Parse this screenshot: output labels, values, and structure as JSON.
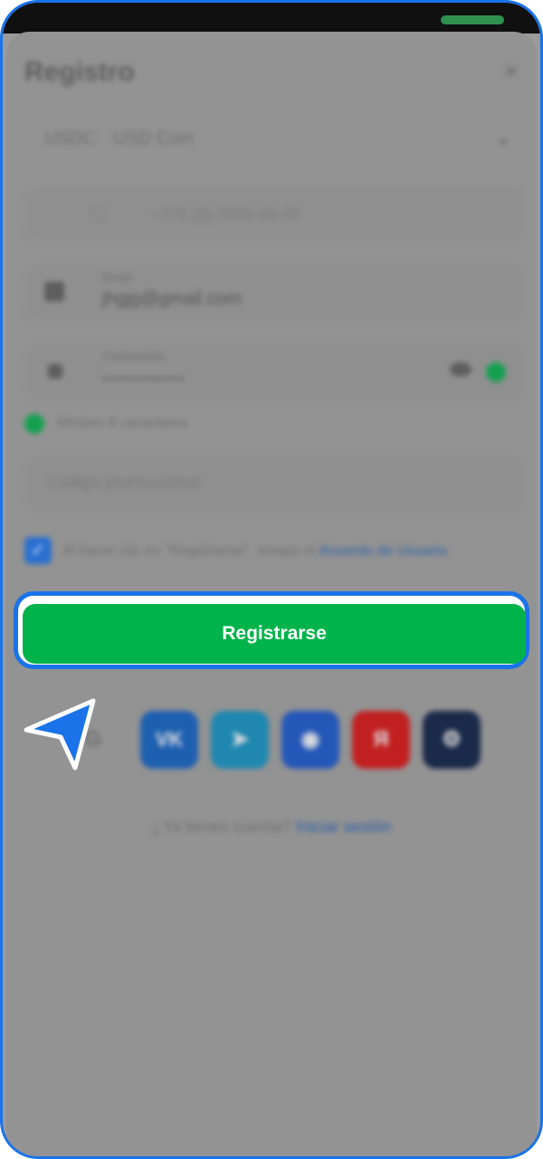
{
  "header": {
    "title": "Registro",
    "close_glyph": "×"
  },
  "currency": {
    "code": "USDC",
    "name": "USD Coin",
    "chevron_glyph": "⌄"
  },
  "phone_field": {
    "value": "+375 (0) 0000-00-00"
  },
  "email_field": {
    "label": "Email",
    "value": "jhgjg@gmail.com"
  },
  "password_field": {
    "label": "Contraseña",
    "value": "••••••••••••••"
  },
  "password_hint": {
    "text": "Mínimo 8 caracteres"
  },
  "promo_field": {
    "placeholder": "Código promocional"
  },
  "terms": {
    "checkbox_glyph": "✓",
    "prefix": "Al hacer clic en \"Registrarse\", acepto el ",
    "link": "Acuerdo de Usuario",
    "suffix": "."
  },
  "actions": {
    "register_label": "Registrarse"
  },
  "socials": {
    "google": "G",
    "vk": "VK",
    "telegram": "➤",
    "ok": "◉",
    "yandex": "Я",
    "steam": "⚙"
  },
  "login": {
    "question": "¿Ya tienes cuenta? ",
    "link": "Iniciar sesión"
  },
  "colors": {
    "accent_blue": "#1a73e8",
    "register_green": "#00b34a",
    "overlay_gray": "#9a9a9a"
  }
}
